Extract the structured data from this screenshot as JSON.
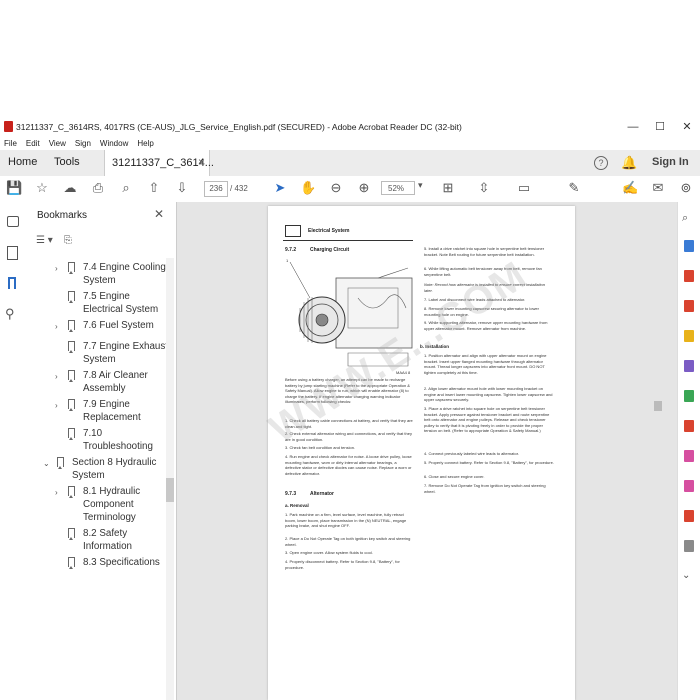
{
  "window": {
    "title": "31211337_C_3614RS, 4017RS (CE-AUS)_JLG_Service_English.pdf (SECURED) - Adobe Acrobat Reader DC (32-bit)",
    "minimize": "—",
    "maximize": "☐",
    "close": "✕"
  },
  "menu": [
    "File",
    "Edit",
    "View",
    "Sign",
    "Window",
    "Help"
  ],
  "tabs": {
    "home": "Home",
    "tools": "Tools",
    "document": "31211337_C_3614...",
    "close": "×",
    "sign_in": "Sign In"
  },
  "toolbar": {
    "page_current": "236",
    "page_total": "/ 432",
    "zoom": "52%"
  },
  "bookmarks": {
    "title": "Bookmarks",
    "close": "✕",
    "items": [
      {
        "label": "7.4 Engine Cooling System",
        "line1": "7.4 Engine Cooling",
        "line2": "System"
      },
      {
        "label": "7.5 Engine Electrical System",
        "line1": "7.5 Engine",
        "line2": "Electrical System"
      },
      {
        "label": "7.6 Fuel System",
        "line1": "7.6 Fuel System",
        "line2": ""
      },
      {
        "label": "7.7 Engine Exhaust System",
        "line1": "7.7 Engine Exhaust",
        "line2": "System"
      },
      {
        "label": "7.8 Air Cleaner Assembly",
        "line1": "7.8 Air Cleaner",
        "line2": "Assembly"
      },
      {
        "label": "7.9 Engine Replacement",
        "line1": "7.9 Engine",
        "line2": "Replacement"
      },
      {
        "label": "7.10 Troubleshooting",
        "line1": "7.10",
        "line2": "Troubleshooting"
      },
      {
        "label": "Section 8 Hydraulic System",
        "line1": "Section 8 Hydraulic",
        "line2": "System"
      },
      {
        "label": "8.1 Hydraulic Component Terminology",
        "line1": "8.1 Hydraulic",
        "line2": "Component",
        "line3": "Terminology"
      },
      {
        "label": "8.2 Safety Information",
        "line1": "8.2 Safety",
        "line2": "Information"
      },
      {
        "label": "8.3 Specifications",
        "line1": "8.3 Specifications",
        "line2": ""
      }
    ]
  },
  "document": {
    "header": "Electrical System",
    "section_num": "9.7.2",
    "section_title": "Charging Circuit",
    "fig_id": "MAA4 8",
    "left_intro": "Before using a battery charger, an attempt can be made to recharge battery by jump starting machine (Refer to the appropriate Operation & Safety Manual). Allow engine to run, which will enable alternator (8) to charge the battery. If engine alternator charging warning indicator illuminates, perform following checks:",
    "left_checks": [
      "1. Check all battery cable connections at battery, and verify that they are clean and tight.",
      "2. Check external alternator wiring and connections, and verify that they are in good condition.",
      "3. Check fan belt condition and tension.",
      "4. Run engine and check alternator for noise. A loose drive pulley, loose mounting hardware, worn or dirty internal alternator bearings, a defective stator or defective diodes can cause noise. Replace a worn or defective alternator."
    ],
    "alt_num": "9.7.3",
    "alt_title": "Alternator",
    "removal_label": "a. Removal",
    "removal_steps": [
      "1. Park machine on a firm, level surface, level machine, fully retract boom, lower boom, place transmission in the (N) NEUTRAL, engage parking brake, and shut engine OFF.",
      "2. Place a Do Not Operate Tag on both ignition key switch and steering wheel.",
      "3. Open engine cover. Allow system fluids to cool.",
      "4. Properly disconnect battery. Refer to Section 9.8, \"Battery\", for procedure."
    ],
    "right_steps_a": [
      "5. Install a drive ratchet into square hole in serpentine belt tensioner bracket. Note Belt routing for future serpentine belt installation.",
      "6. While lifting automatic belt tensioner away from belt, remove fan serpentine belt."
    ],
    "note": "Note: Record how alternator is installed to ensure correct installation later.",
    "right_steps_b": [
      "7. Label and disconnect wire leads attached to alternator.",
      "8. Remove lower mounting capscrew securing alternator to lower mounting hole on engine.",
      "9. While supporting alternator, remove upper mounting hardware from upper alternator mount. Remove alternator from machine."
    ],
    "install_label": "b. Installation",
    "install_steps": [
      "1. Position alternator and align with upper alternator mount on engine bracket. Insert upper flanged mounting hardware through alternator mount. Thread longer capscrew into alternator front mount. DO NOT tighten completely at this time.",
      "2. Align lower alternator mount hole with lower mounting bracket on engine and insert lower mounting capscrew. Tighten lower capscrew and upper capscrew securely.",
      "3. Place a drive ratchet into square hole on serpentine belt tensioner bracket. Apply pressure against tensioner bracket and route serpentine belt onto alternator and engine pulleys. Release and check tensioner pulley to verify that it is pivoting freely in order to provide the proper tension on belt. (Refer to appropriate Operation & Safety Manual.)",
      "4. Connect previously labeled wire leads to alternator.",
      "5. Properly connect battery. Refer to Section 9.8, \"Battery\", for procedure.",
      "6. Close and secure engine cover.",
      "7. Remove Do Not Operate Tag from ignition key switch and steering wheel."
    ],
    "watermark": "WWW.E...COM"
  }
}
